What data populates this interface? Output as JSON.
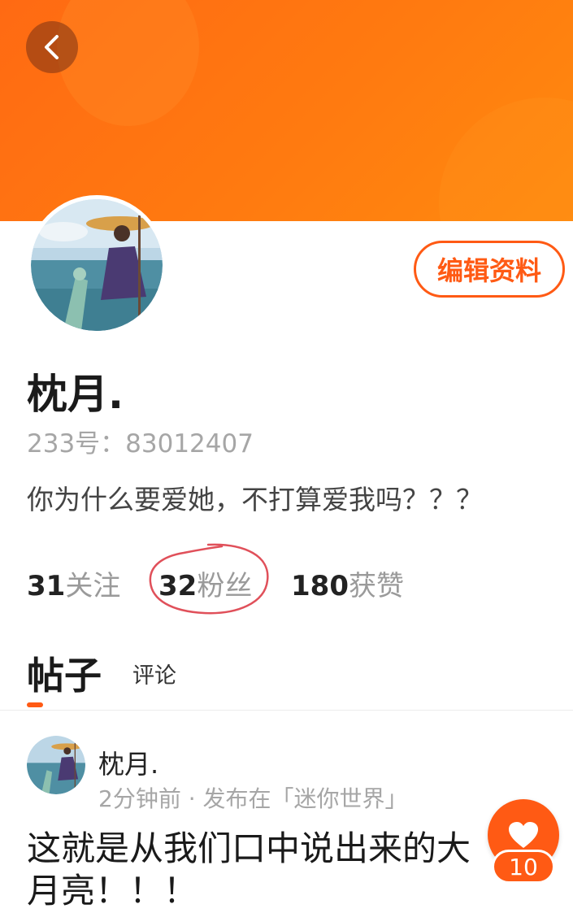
{
  "header": {
    "back_icon": "chevron-left-icon",
    "banner_color": "#ff7a10"
  },
  "profile": {
    "avatar": "profile-avatar-anime-girl-umbrella",
    "edit_label": "编辑资料",
    "username": "枕月.",
    "uid": "233号：83012407",
    "bio": "你为什么要爱她，不打算爱我吗？？？",
    "stats": {
      "following": {
        "count": "31",
        "label": "关注"
      },
      "followers": {
        "count": "32",
        "label": "粉丝"
      },
      "likes": {
        "count": "180",
        "label": "获赞"
      }
    }
  },
  "tabs": {
    "posts": "帖子",
    "comments": "评论",
    "active": "posts"
  },
  "post": {
    "author": "枕月.",
    "meta": "2分钟前 · 发布在「迷你世界」",
    "content": "这就是从我们口中说出来的大月亮！！！"
  },
  "like_button": {
    "icon": "heart-icon",
    "count": "10"
  },
  "colors": {
    "accent": "#ff5a14",
    "secondary_text": "#a6a6a6",
    "annotation_red": "#e0505a"
  }
}
